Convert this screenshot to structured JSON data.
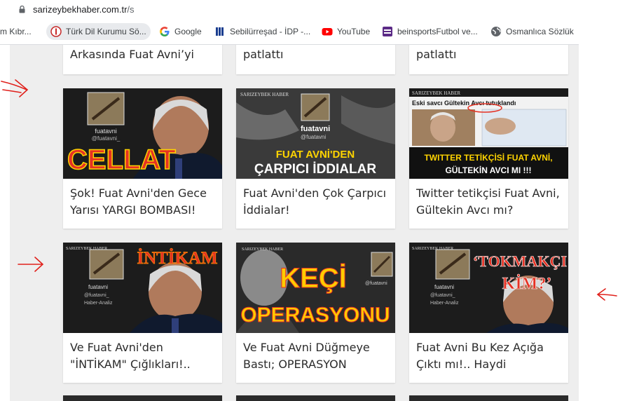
{
  "browser": {
    "url_domain": "sarizeybekhaber.com.tr",
    "url_path": "/s",
    "bookmarks": [
      {
        "label": "m Kıbr...",
        "icon": "page-icon"
      },
      {
        "label": "Türk Dil Kurumu Sö...",
        "icon": "tdk-icon"
      },
      {
        "label": "Google",
        "icon": "google-icon"
      },
      {
        "label": "Sebilürreşad - İDP -...",
        "icon": "book-icon"
      },
      {
        "label": "YouTube",
        "icon": "youtube-icon"
      },
      {
        "label": "beinsportsFutbol ve...",
        "icon": "beinsports-icon"
      },
      {
        "label": "Osmanlıca Sözlük",
        "icon": "globe-icon"
      }
    ]
  },
  "cards": [
    {
      "title": "Arkasında Fuat Avni’yi"
    },
    {
      "title": "patlattı"
    },
    {
      "title": "patlattı"
    },
    {
      "title": "Şok! Fuat Avni'den Gece Yarısı YARGI BOMBASI!",
      "overlay": "CELLAT",
      "handle_name": "fuatavni",
      "handle": "@fuatavni_"
    },
    {
      "title": "Fuat Avni'den Çok Çarpıcı İddialar!",
      "overlay1": "FUAT AVNİ'DEN",
      "overlay2": "ÇARPICI İDDIALAR",
      "brand": "SARIZEYBEK HABER",
      "handle_name": "fuatavni",
      "handle": "@fuatavni"
    },
    {
      "title": "Twitter tetikçisi Fuat Avni, Gültekin Avcı mı?",
      "brand": "SARIZEYBEK HABER",
      "headline": "Eski savcı Gültekin Avcı tutuklandı",
      "overlay1": "TWITTER TETİKÇİSİ FUAT AVNİ,",
      "overlay2": "GÜLTEKİN AVCI MI !!!"
    },
    {
      "title": "Ve Fuat Avni'den \"İNTİKAM\" Çığlıkları!..",
      "brand": "SARIZEYBEK HABER",
      "overlay": "İNTİKAM",
      "handle_name": "fuatavni",
      "handle": "@fuatavni_",
      "tag": "Haber-Analiz"
    },
    {
      "title": "Ve Fuat Avni Düğmeye Bastı; OPERASYON",
      "brand": "SARIZEYBEK HABER",
      "overlay1": "KEÇİ",
      "overlay2": "OPERASYONU",
      "handle": "@fuatavni"
    },
    {
      "title": "Fuat Avni Bu Kez Açığa Çıktı mı!.. Haydi",
      "brand": "SARIZEYBEK HABER",
      "overlay1": "‘TOKMAKÇI",
      "overlay2": "KİM?’",
      "handle_name": "fuatavni",
      "handle": "@fuatavni_",
      "tag": "Haber-Analiz"
    }
  ],
  "colors": {
    "arrow": "#e0201b",
    "page_bg": "#eeeeee",
    "title_text": "#2b2b2b"
  }
}
